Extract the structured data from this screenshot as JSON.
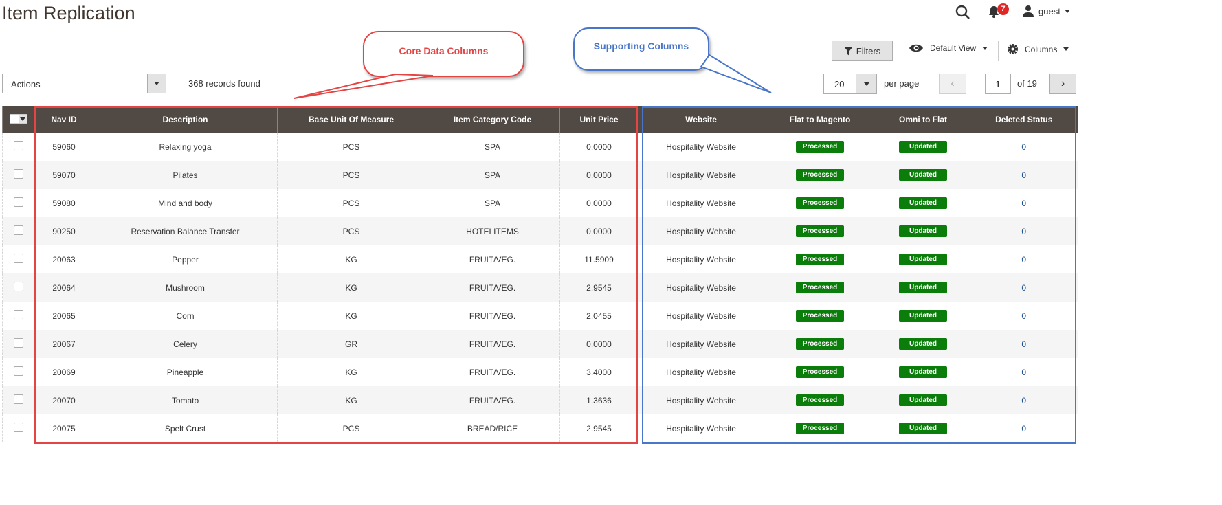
{
  "header": {
    "title": "Item Replication",
    "notifications": "7",
    "user": "guest"
  },
  "toolbar": {
    "filters": "Filters",
    "view": "Default View",
    "columns": "Columns",
    "actions": "Actions",
    "records": "368 records found",
    "per_page_value": "20",
    "per_page_label": "per page",
    "page": "1",
    "of_pages": "of 19"
  },
  "annotations": {
    "core": "Core Data Columns",
    "supporting": "Supporting Columns",
    "core_color": "#e54444",
    "supporting_color": "#4a76c9"
  },
  "columns": [
    "Nav ID",
    "Description",
    "Base Unit Of Measure",
    "Item Category Code",
    "Unit Price",
    "Website",
    "Flat to Magento",
    "Omni to Flat",
    "Deleted Status"
  ],
  "rows": [
    [
      "59060",
      "Relaxing yoga",
      "PCS",
      "SPA",
      "0.0000",
      "Hospitality Website",
      "Processed",
      "Updated",
      "0"
    ],
    [
      "59070",
      "Pilates",
      "PCS",
      "SPA",
      "0.0000",
      "Hospitality Website",
      "Processed",
      "Updated",
      "0"
    ],
    [
      "59080",
      "Mind and body",
      "PCS",
      "SPA",
      "0.0000",
      "Hospitality Website",
      "Processed",
      "Updated",
      "0"
    ],
    [
      "90250",
      "Reservation Balance Transfer",
      "PCS",
      "HOTELITEMS",
      "0.0000",
      "Hospitality Website",
      "Processed",
      "Updated",
      "0"
    ],
    [
      "20063",
      "Pepper",
      "KG",
      "FRUIT/VEG.",
      "11.5909",
      "Hospitality Website",
      "Processed",
      "Updated",
      "0"
    ],
    [
      "20064",
      "Mushroom",
      "KG",
      "FRUIT/VEG.",
      "2.9545",
      "Hospitality Website",
      "Processed",
      "Updated",
      "0"
    ],
    [
      "20065",
      "Corn",
      "KG",
      "FRUIT/VEG.",
      "2.0455",
      "Hospitality Website",
      "Processed",
      "Updated",
      "0"
    ],
    [
      "20067",
      "Celery",
      "GR",
      "FRUIT/VEG.",
      "0.0000",
      "Hospitality Website",
      "Processed",
      "Updated",
      "0"
    ],
    [
      "20069",
      "Pineapple",
      "KG",
      "FRUIT/VEG.",
      "3.4000",
      "Hospitality Website",
      "Processed",
      "Updated",
      "0"
    ],
    [
      "20070",
      "Tomato",
      "KG",
      "FRUIT/VEG.",
      "1.3636",
      "Hospitality Website",
      "Processed",
      "Updated",
      "0"
    ],
    [
      "20075",
      "Spelt Crust",
      "PCS",
      "BREAD/RICE",
      "2.9545",
      "Hospitality Website",
      "Processed",
      "Updated",
      "0"
    ]
  ]
}
